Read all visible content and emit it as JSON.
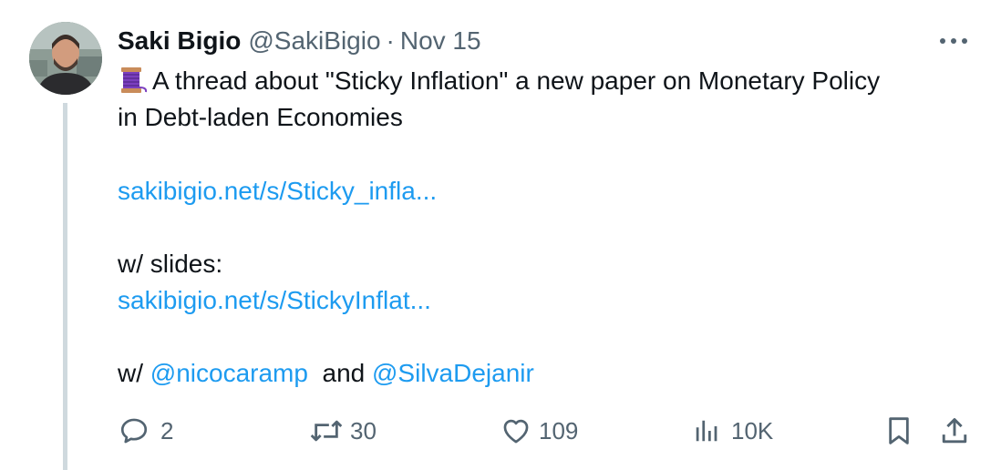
{
  "tweet": {
    "author_name": "Saki Bigio",
    "handle": "@SakiBigio",
    "separator": "·",
    "date": "Nov 15",
    "line1": "A thread about \"Sticky Inflation\" a new paper on Monetary Policy",
    "line2": "in Debt-laden Economies",
    "link1": "sakibigio.net/s/Sticky_infla...",
    "slides_label": "w/ slides:",
    "link2": "sakibigio.net/s/StickyInflat...",
    "with_prefix": "w/",
    "mention1": "@nicocaramp",
    "conjunction": "and",
    "mention2": "@SilvaDejanir"
  },
  "actions": {
    "replies": "2",
    "reposts": "30",
    "likes": "109",
    "views": "10K"
  },
  "icons": {
    "emoji": "spool-of-thread-icon",
    "more": "more-dots-icon",
    "reply": "reply-icon",
    "repost": "repost-icon",
    "like": "heart-icon",
    "views": "views-chart-icon",
    "bookmark": "bookmark-icon",
    "share": "share-icon"
  },
  "colors": {
    "link": "#1d9bf0",
    "text": "#0f1419",
    "secondary": "#536471",
    "thread_line": "#cfd9de"
  }
}
